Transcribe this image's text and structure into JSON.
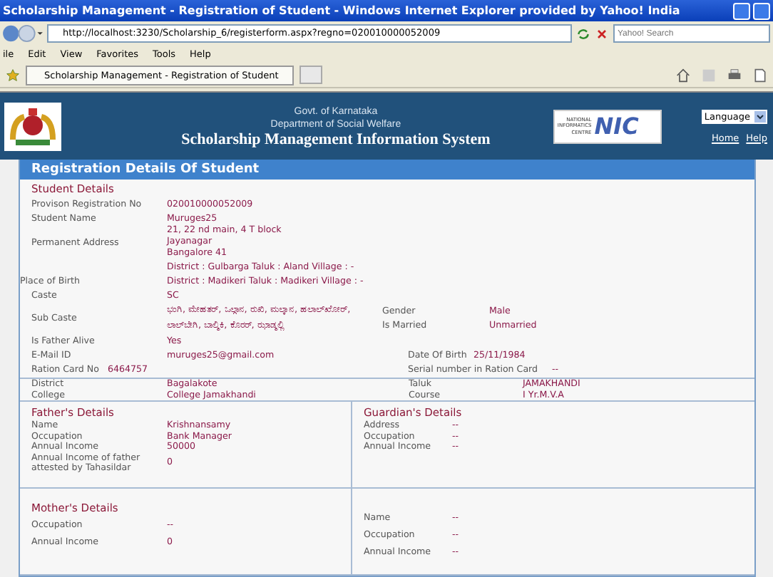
{
  "window": {
    "title": "Scholarship Management - Registration of Student - Windows Internet Explorer provided by Yahoo! India"
  },
  "address_bar": {
    "url": "http://localhost:3230/Scholarship_6/registerform.aspx?regno=020010000052009",
    "search_placeholder": "Yahoo! Search"
  },
  "menu": [
    "ile",
    "Edit",
    "View",
    "Favorites",
    "Tools",
    "Help"
  ],
  "tab": {
    "label": "Scholarship Management - Registration of Student"
  },
  "header": {
    "line1": "Govt. of Karnataka",
    "line2": "Department of Social Welfare",
    "title": "Scholarship Management Information System",
    "logo_text": [
      "NATIONAL",
      "INFORMATICS",
      "CENTRE",
      "NIC"
    ],
    "language": "Language",
    "links": [
      "Home",
      "Help"
    ]
  },
  "page_title": "Registration Details Of Student",
  "student": {
    "heading": "Student Details",
    "registration": {
      "label": "Provison Registration No",
      "value": "020010000052009"
    },
    "name": {
      "label": "Student Name",
      "value": "Muruges25"
    },
    "address": {
      "label": "Permanent Address",
      "lines": [
        "21, 22 nd main, 4 T block",
        "Jayanagar",
        "Bangalore 41"
      ]
    },
    "native": "District : Gulbarga  Taluk : Aland  Village : -",
    "birth_place": {
      "label": "Place of Birth",
      "value": "District : Madikeri  Taluk : Madikeri  Village : -"
    },
    "caste": {
      "label": "Caste",
      "value": "SC"
    },
    "sub_caste": {
      "label": "Sub Caste",
      "value": "ಭಂಗಿ, ಮೇಹತರ್, ಒಲ್ಗಾನ, ರುಖಿ, ಮಲ್ಕಾನ, ಹಲಾಲ್‌ಖೋರ್, ಲಾಲ್‌ಬೇಗಿ, ಬಾಲ್ಮಿಕಿ, ಕೊರರ್, ಝಾಡ್ಮಲ್ಲಿ"
    },
    "gender": {
      "label": "Gender",
      "value": "Male"
    },
    "married": {
      "label": "Is Married",
      "value": "Unmarried"
    },
    "father_alive": {
      "label": "Is Father Alive",
      "value": "Yes"
    },
    "email": {
      "label": "E-Mail ID",
      "value": "muruges25@gmail.com"
    },
    "dob": {
      "label": "Date Of Birth",
      "value": "25/11/1984"
    },
    "ration_card": {
      "label": "Ration Card No",
      "value": "6464757"
    },
    "ration_serial": {
      "label": "Serial number in Ration Card",
      "value": "--"
    }
  },
  "course": {
    "district": {
      "label": "District",
      "value": "Bagalakote"
    },
    "taluk": {
      "label": "Taluk",
      "value": "JAMAKHANDI"
    },
    "college": {
      "label": "College",
      "value": "College Jamakhandi"
    },
    "course": {
      "label": "Course",
      "value": "I Yr.M.V.A"
    }
  },
  "father": {
    "heading": "Father's Details",
    "fields": [
      {
        "label": "Name",
        "value": "Krishnansamy"
      },
      {
        "label": "Occupation",
        "value": "Bank Manager"
      },
      {
        "label": "Annual Income",
        "value": "50000"
      },
      {
        "label": "Annual Income of father attested by Tahasildar",
        "value": "0"
      }
    ]
  },
  "guardian": {
    "heading": "Guardian's Details",
    "fields": [
      {
        "label": "Address",
        "value": "--"
      },
      {
        "label": "Occupation",
        "value": "--"
      },
      {
        "label": "Annual Income",
        "value": "--"
      }
    ]
  },
  "mother": {
    "heading": "Mother's Details",
    "fields": [
      {
        "label": "Occupation",
        "value": "--"
      },
      {
        "label": "Annual Income",
        "value": "0"
      }
    ]
  },
  "other": {
    "fields": [
      {
        "label": "Name",
        "value": "--"
      },
      {
        "label": "Occupation",
        "value": "--"
      },
      {
        "label": "Annual Income",
        "value": "--"
      }
    ]
  }
}
